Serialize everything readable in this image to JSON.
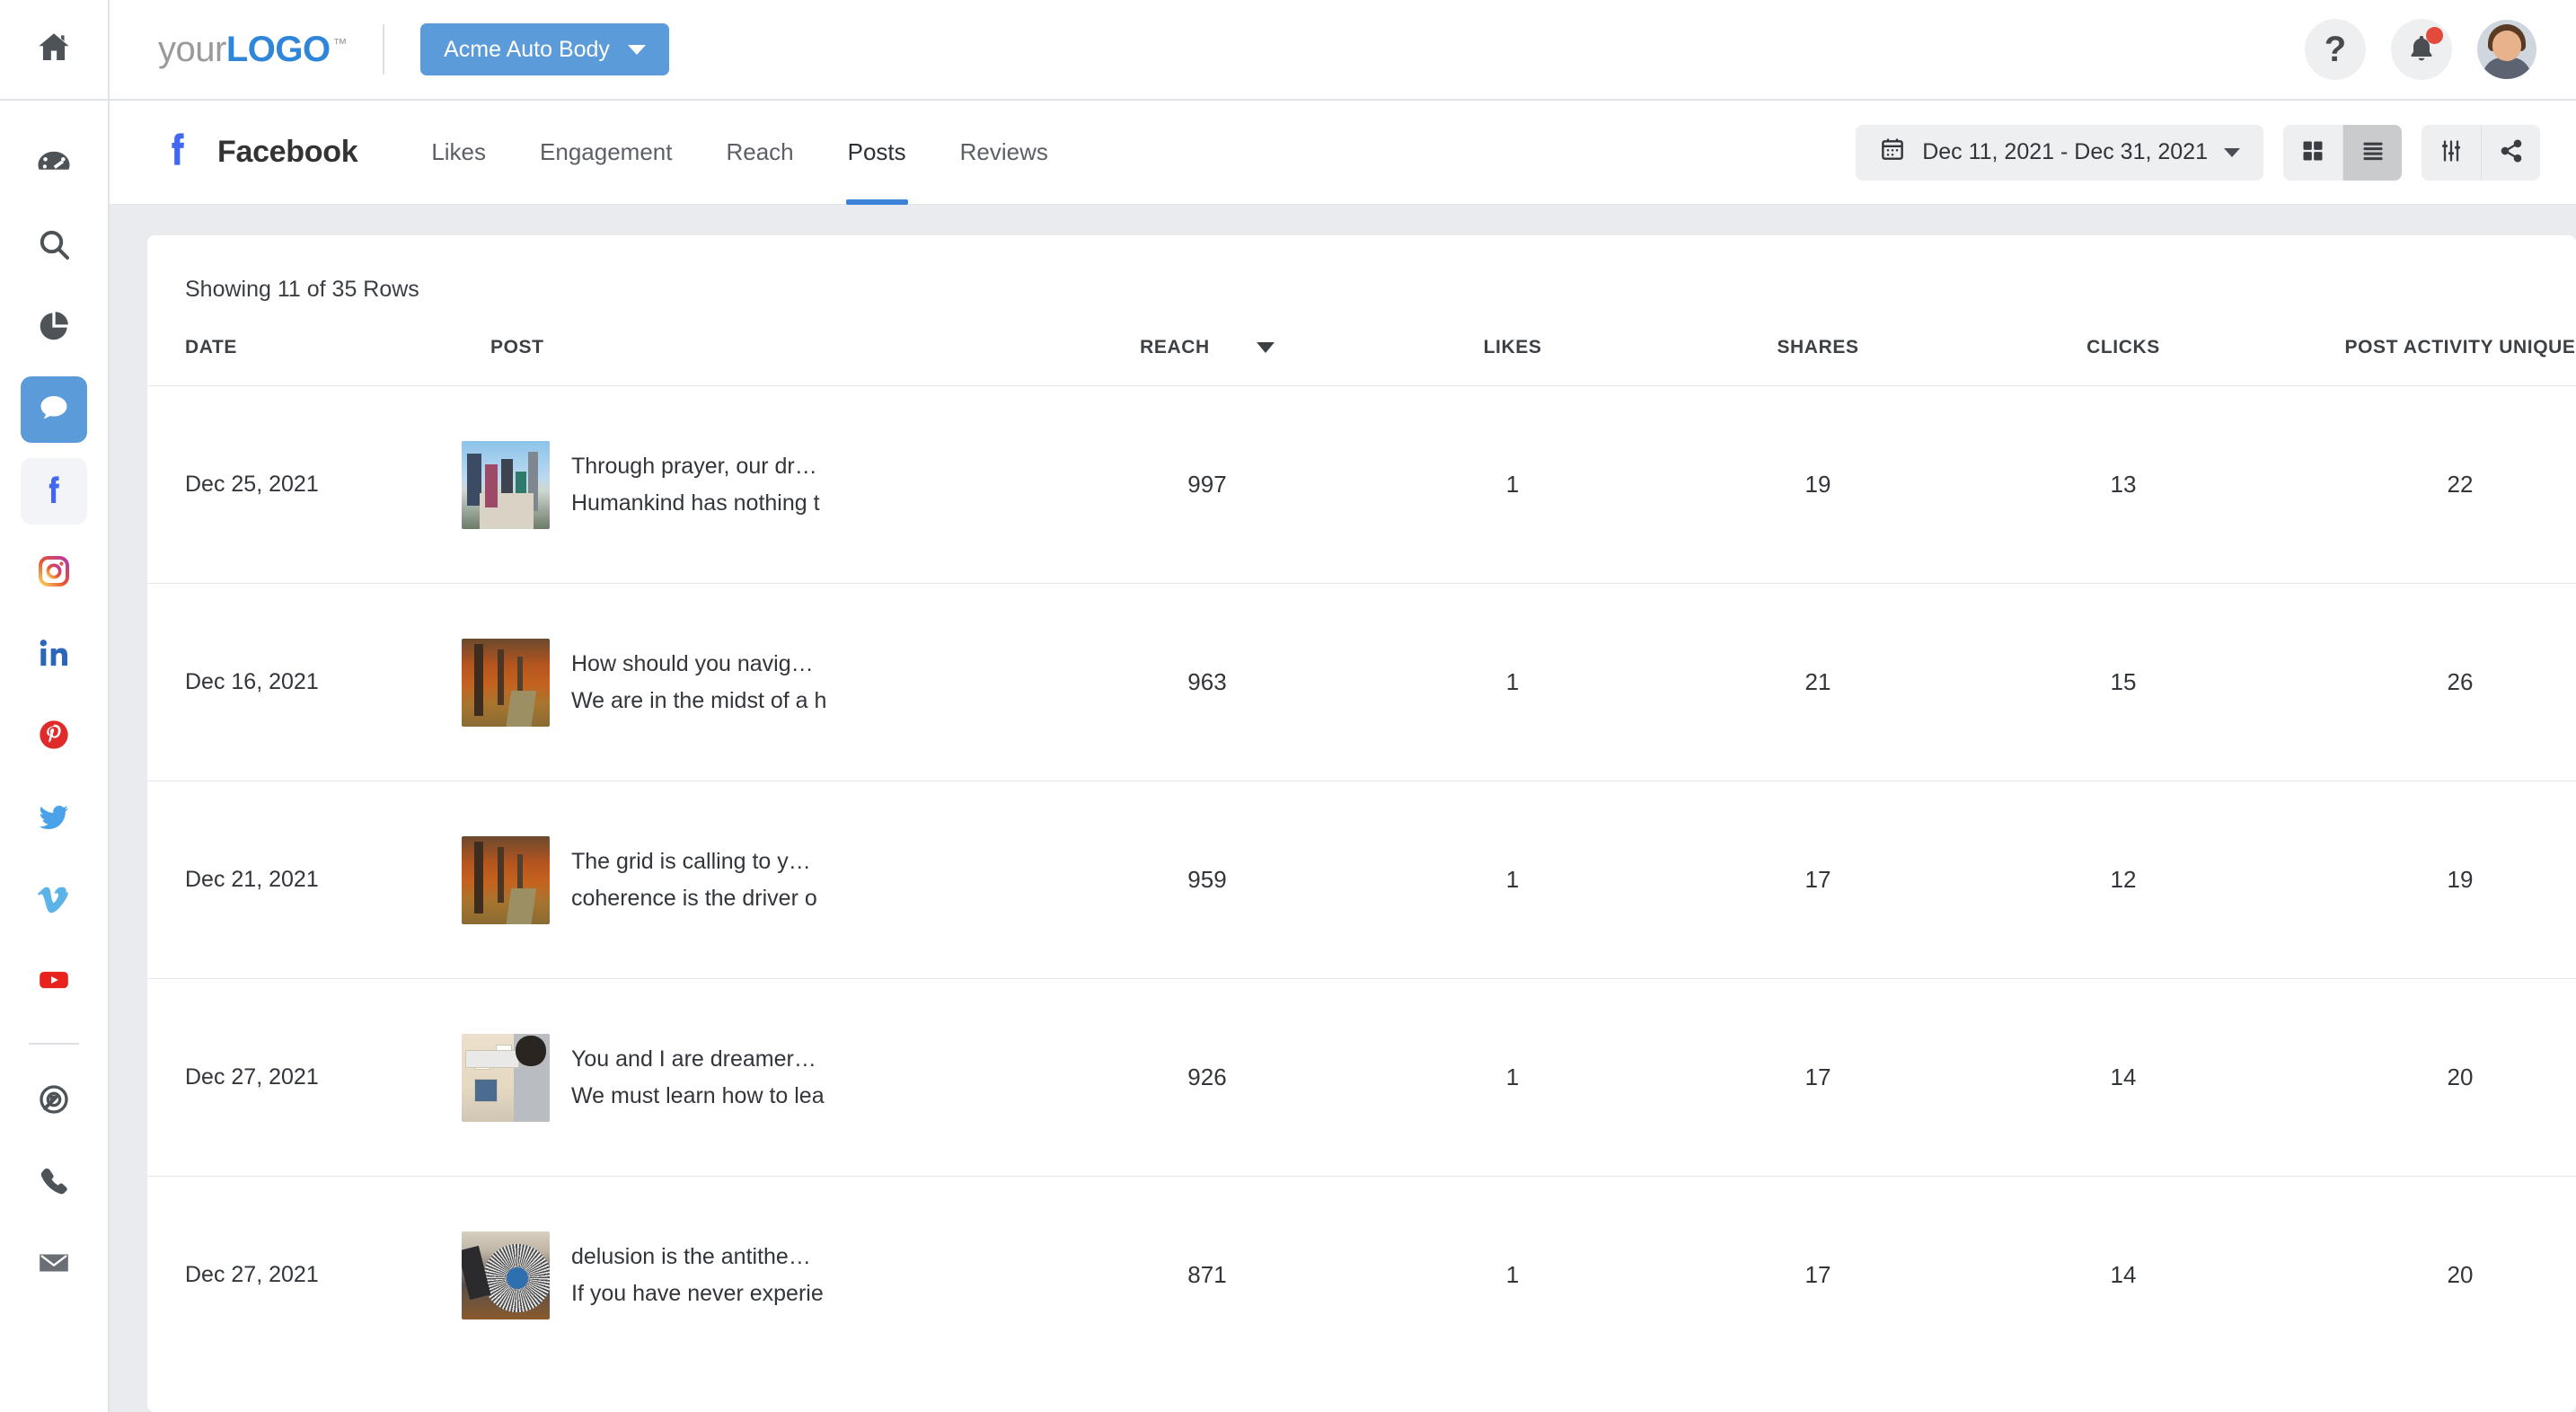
{
  "brand": {
    "logo_your": "your",
    "logo_logo": "LOGO",
    "logo_tm": "™",
    "account": "Acme Auto Body"
  },
  "topbar": {
    "help_icon": "question-mark-icon",
    "notifications_icon": "bell-icon",
    "avatar_icon": "user-avatar",
    "help_glyph": "?"
  },
  "sidebar": {
    "items": [
      {
        "name": "home-icon",
        "label": "Home"
      },
      {
        "name": "dashboard-gauge-icon",
        "label": "Dashboard"
      },
      {
        "name": "search-icon",
        "label": "Search"
      },
      {
        "name": "pie-chart-icon",
        "label": "Reports"
      },
      {
        "name": "chat-bubble-icon",
        "label": "Social"
      },
      {
        "name": "facebook-icon",
        "label": "Facebook"
      },
      {
        "name": "instagram-icon",
        "label": "Instagram"
      },
      {
        "name": "linkedin-icon",
        "label": "LinkedIn"
      },
      {
        "name": "pinterest-icon",
        "label": "Pinterest"
      },
      {
        "name": "twitter-icon",
        "label": "Twitter"
      },
      {
        "name": "vimeo-icon",
        "label": "Vimeo"
      },
      {
        "name": "youtube-icon",
        "label": "YouTube"
      },
      {
        "name": "target-icon",
        "label": "Ads"
      },
      {
        "name": "phone-icon",
        "label": "Calls"
      },
      {
        "name": "email-icon",
        "label": "Email"
      }
    ]
  },
  "channel": {
    "name": "Facebook",
    "icon": "facebook-f-icon",
    "tabs": [
      {
        "label": "Likes",
        "active": false
      },
      {
        "label": "Engagement",
        "active": false
      },
      {
        "label": "Reach",
        "active": false
      },
      {
        "label": "Posts",
        "active": true
      },
      {
        "label": "Reviews",
        "active": false
      }
    ],
    "date_range": "Dec 11, 2021 - Dec 31, 2021",
    "calendar_icon": "calendar-icon",
    "view_grid_icon": "grid-view-icon",
    "view_list_icon": "list-view-icon",
    "filter_icon": "filter-sliders-icon",
    "share_icon": "share-icon",
    "active_view": "list"
  },
  "table": {
    "rows_label": "Showing 11 of 35 Rows",
    "showing": 11,
    "total": 35,
    "sort_column": "REACH",
    "sort_direction": "desc",
    "columns": [
      "DATE",
      "POST",
      "REACH",
      "LIKES",
      "SHARES",
      "CLICKS",
      "POST ACTIVITY UNIQUE"
    ],
    "rows": [
      {
        "date": "Dec 25, 2021",
        "thumb": "city-skyline",
        "line1": "Through prayer, our dr…",
        "line2": "Humankind has nothing t",
        "reach": "997",
        "likes": "1",
        "shares": "19",
        "clicks": "13",
        "activity": "22"
      },
      {
        "date": "Dec 16, 2021",
        "thumb": "autumn-path",
        "line1": "How should you navig…",
        "line2": "We are in the midst of a h",
        "reach": "963",
        "likes": "1",
        "shares": "21",
        "clicks": "15",
        "activity": "26"
      },
      {
        "date": "Dec 21, 2021",
        "thumb": "autumn-path",
        "line1": "The grid is calling to y…",
        "line2": "coherence is the driver o",
        "reach": "959",
        "likes": "1",
        "shares": "17",
        "clicks": "12",
        "activity": "19"
      },
      {
        "date": "Dec 27, 2021",
        "thumb": "office-meeting",
        "line1": "You and I are dreamer…",
        "line2": "We must learn how to lea",
        "reach": "926",
        "likes": "1",
        "shares": "17",
        "clicks": "14",
        "activity": "20"
      },
      {
        "date": "Dec 27, 2021",
        "thumb": "dj-turntable",
        "line1": "delusion is the antithe…",
        "line2": "If you have never experie",
        "reach": "871",
        "likes": "1",
        "shares": "17",
        "clicks": "14",
        "activity": "20"
      }
    ]
  },
  "colors": {
    "accent": "#5b9bd9",
    "tab_underline": "#3c82d6",
    "facebook": "#4267f0",
    "page_bg": "#e9ebee",
    "badge": "#e24a3b"
  }
}
